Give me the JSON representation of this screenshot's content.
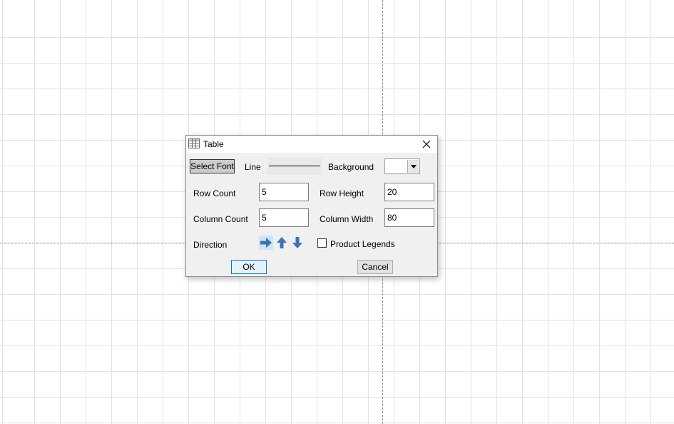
{
  "dialog": {
    "title": "Table",
    "title_icon": "table-icon",
    "close_icon": "close-icon"
  },
  "toolbar": {
    "select_font_label": "Select Font",
    "line_label": "Line",
    "background_label": "Background",
    "background_color": "#ffffff"
  },
  "fields": {
    "row_count_label": "Row Count",
    "row_count_value": "5",
    "row_height_label": "Row Height",
    "row_height_value": "20",
    "column_count_label": "Column Count",
    "column_count_value": "5",
    "column_width_label": "Column Width",
    "column_width_value": "80"
  },
  "direction": {
    "label": "Direction",
    "options": [
      "arrow-right-icon",
      "arrow-up-icon",
      "arrow-down-icon"
    ],
    "selected": "arrow-right-icon",
    "icon_color": "#3d72b4"
  },
  "product_legends": {
    "label": "Product Legends",
    "checked": false
  },
  "buttons": {
    "ok_label": "OK",
    "cancel_label": "Cancel"
  }
}
